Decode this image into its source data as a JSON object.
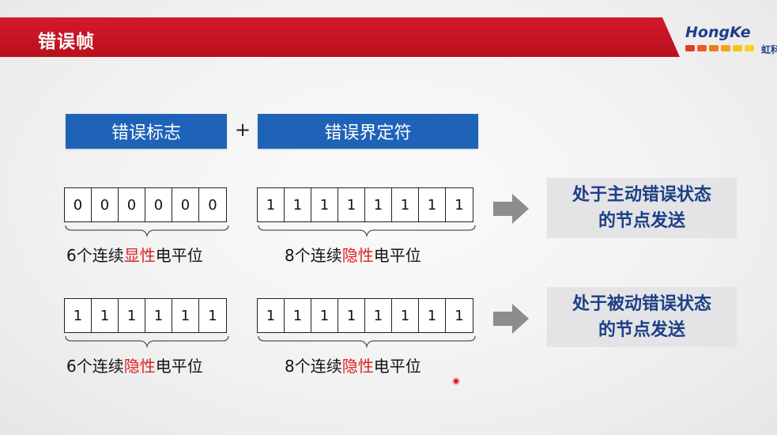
{
  "header": {
    "title": "错误帧"
  },
  "logo": {
    "text": "HongKe",
    "sub": "虹科",
    "dot_colors": [
      "#e53a1f",
      "#ef5a1f",
      "#f37a1a",
      "#f7a11a",
      "#f9c21a",
      "#f5d51e"
    ]
  },
  "frame": {
    "flag_label": "错误标志",
    "plus": "+",
    "delimiter_label": "错误界定符"
  },
  "rows": [
    {
      "flag_bits": [
        "0",
        "0",
        "0",
        "0",
        "0",
        "0"
      ],
      "flag_caption": {
        "prefix": "6个连续",
        "highlight": "显性",
        "suffix": "电平位"
      },
      "delim_bits": [
        "1",
        "1",
        "1",
        "1",
        "1",
        "1",
        "1",
        "1"
      ],
      "delim_caption": {
        "prefix": "8个连续",
        "highlight": "隐性",
        "suffix": "电平位"
      },
      "state": {
        "line1": "处于主动错误状态",
        "line2": "的节点发送"
      }
    },
    {
      "flag_bits": [
        "1",
        "1",
        "1",
        "1",
        "1",
        "1"
      ],
      "flag_caption": {
        "prefix": "6个连续",
        "highlight": "隐性",
        "suffix": "电平位"
      },
      "delim_bits": [
        "1",
        "1",
        "1",
        "1",
        "1",
        "1",
        "1",
        "1"
      ],
      "delim_caption": {
        "prefix": "8个连续",
        "highlight": "隐性",
        "suffix": "电平位"
      },
      "state": {
        "line1": "处于被动错误状态",
        "line2": "的节点发送"
      }
    }
  ],
  "colors": {
    "header_red": "#c8141f",
    "box_blue": "#1f63b8",
    "state_text": "#1c3f86",
    "highlight_red": "#e02020"
  }
}
